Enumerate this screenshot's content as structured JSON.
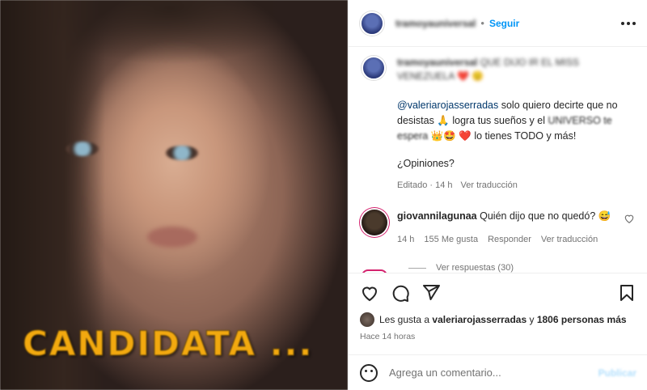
{
  "post": {
    "overlay_text": "CANDIDATA ...",
    "author": "tramoyauniversal",
    "follow_label": "Seguir"
  },
  "caption": {
    "author": "tramoyauniversal",
    "headline": "QUE DIJO IR EL MISS VENEZUELA ❤️ 😟",
    "mention": "@valeriarojasserradas",
    "text_1": " solo quiero decirte que no desistas 🙏 logra tus sueños y el ",
    "text_universe": "UNIVERSO te espera",
    "text_emojis": " 👑🤩 ❤️",
    "text_2": " lo tienes TODO y más!",
    "question": "¿Opiniones?",
    "meta_edited": "Editado · 14 h",
    "meta_translate": "Ver traducción"
  },
  "comment": {
    "user": "giovannilagunaa",
    "text": " Quién dijo que no quedó? 😅",
    "time": "14 h",
    "likes": "155 Me gusta",
    "reply": "Responder",
    "translate": "Ver traducción",
    "view_replies": "Ver respuestas (30)"
  },
  "likes": {
    "prefix": "Les gusta a ",
    "user": "valeriarojasserradas",
    "middle": " y ",
    "count": "1806 personas más"
  },
  "timestamp": "Hace 14 horas",
  "add_comment": {
    "placeholder": "Agrega un comentario...",
    "publish_label": "Publicar"
  }
}
